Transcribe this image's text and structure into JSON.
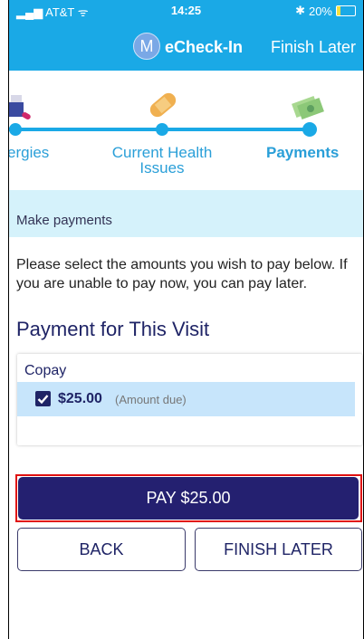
{
  "status_bar": {
    "carrier": "AT&T",
    "time": "14:25",
    "battery": "20%",
    "battery_level": 0.2
  },
  "nav": {
    "avatar_letter": "M",
    "title": "eCheck-In",
    "finish_later": "Finish Later"
  },
  "stepper": {
    "steps": [
      {
        "label": "ergies",
        "icon": "allergy-icon"
      },
      {
        "label": "Current Health Issues",
        "line1": "Current Health",
        "line2": "Issues",
        "icon": "bandage-icon"
      },
      {
        "label": "Payments",
        "icon": "money-icon",
        "active": true
      }
    ]
  },
  "banner": {
    "text": "Make payments"
  },
  "instructions": "Please select the amounts you wish to pay below. If you are unable to pay now, you can pay later.",
  "section_title": "Payment for This Visit",
  "copay": {
    "label": "Copay",
    "amount": "$25.00",
    "note": "(Amount due)",
    "checked": true
  },
  "buttons": {
    "pay": "PAY $25.00",
    "back": "BACK",
    "finish_later": "FINISH LATER"
  },
  "colors": {
    "header": "#1aa9e6",
    "primary": "#242070",
    "banner": "#d5f2fb",
    "selected_row": "#c7e5fb",
    "highlight_outline": "#e01010"
  }
}
